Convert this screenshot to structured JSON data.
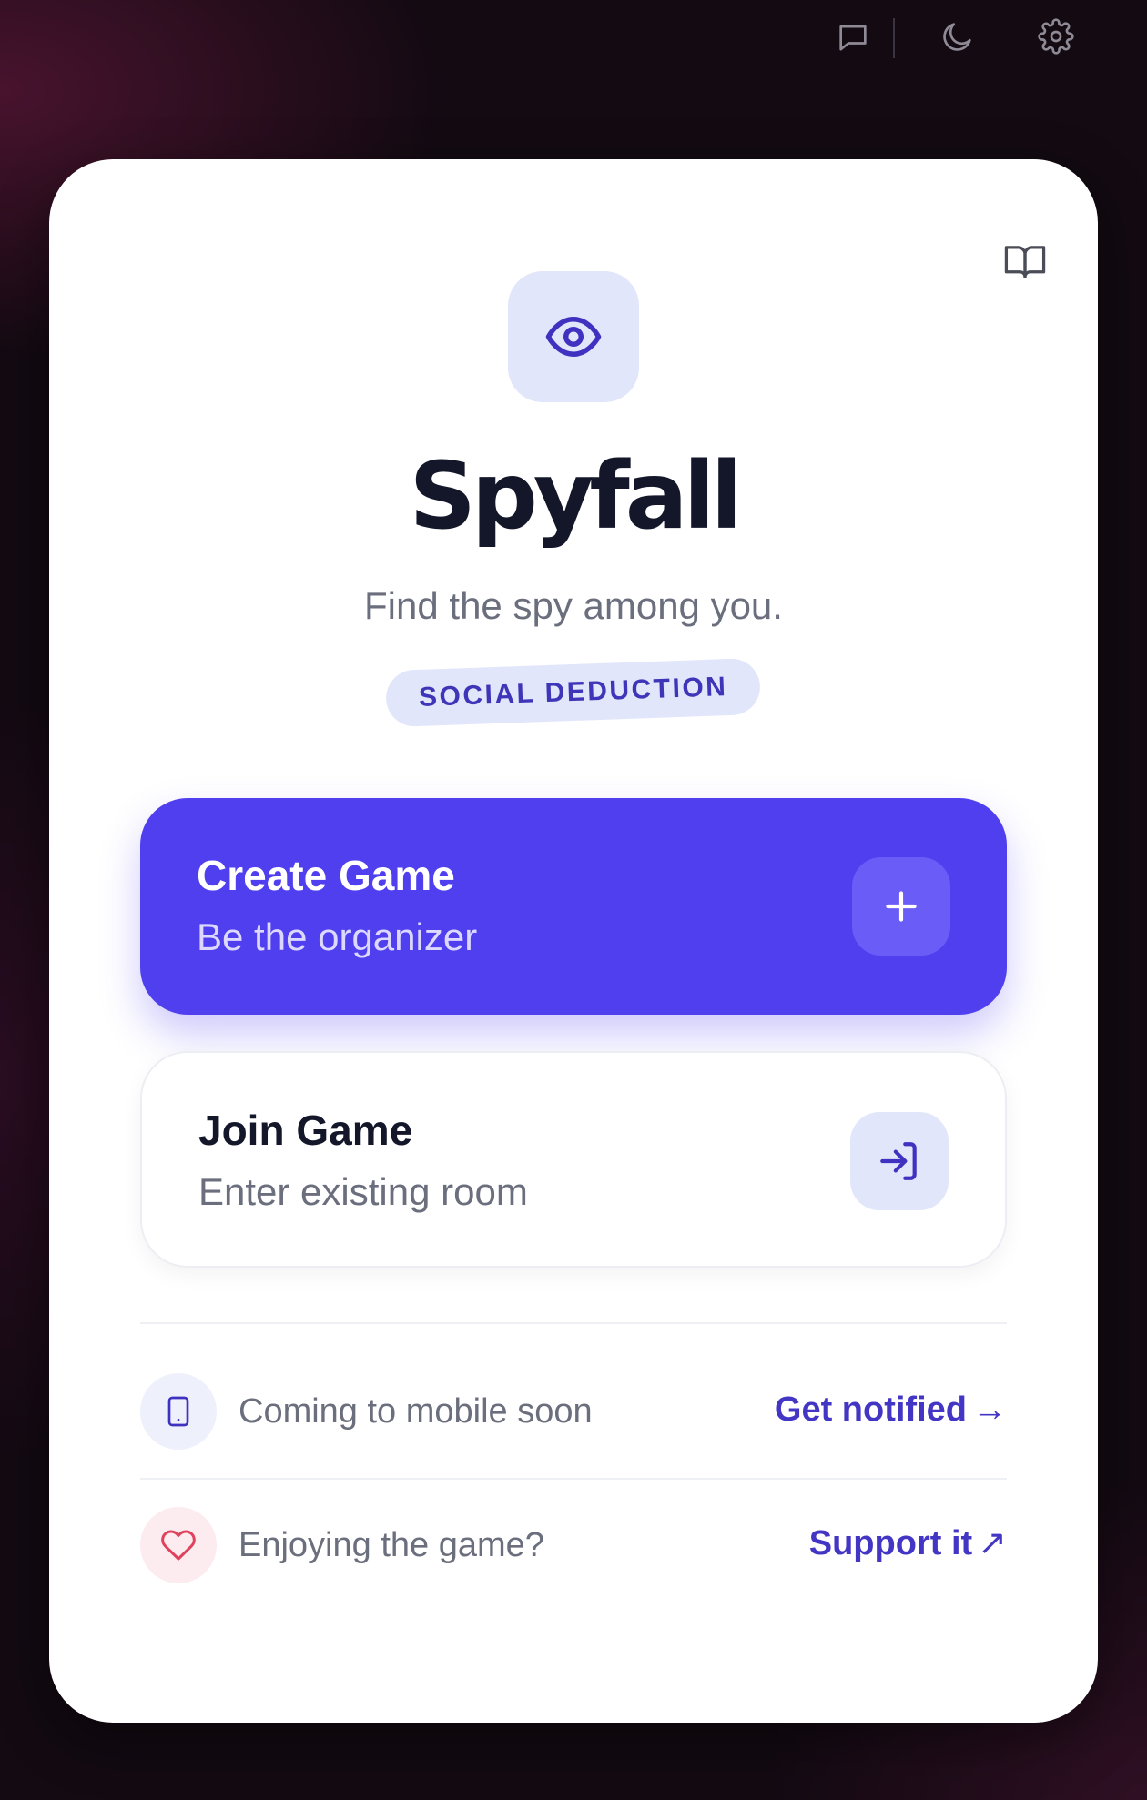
{
  "topbar": {
    "icons": [
      "feedback-message-icon",
      "moon-icon",
      "gear-icon"
    ]
  },
  "card": {
    "guide_icon": "book-open-icon",
    "logo_icon": "eye-icon",
    "title": "Spyfall",
    "tagline": "Find the spy among you.",
    "badge": "SOCIAL DEDUCTION",
    "create": {
      "title": "Create Game",
      "subtitle": "Be the organizer",
      "icon": "plus-icon"
    },
    "join": {
      "title": "Join Game",
      "subtitle": "Enter existing room",
      "icon": "log-in-icon"
    },
    "mobile": {
      "text": "Coming to mobile soon",
      "link": "Get notified",
      "link_arrow": "→",
      "icon": "smartphone-icon"
    },
    "support": {
      "text": "Enjoying the game?",
      "link": "Support it",
      "link_arrow": "↗",
      "icon": "heart-icon"
    }
  },
  "colors": {
    "accent": "#4f3fef",
    "accent_text": "#4436c4",
    "tile_bg": "#e1e6fb",
    "heart": "#e0425e",
    "heart_bg": "#fdecef",
    "title": "#131729"
  }
}
